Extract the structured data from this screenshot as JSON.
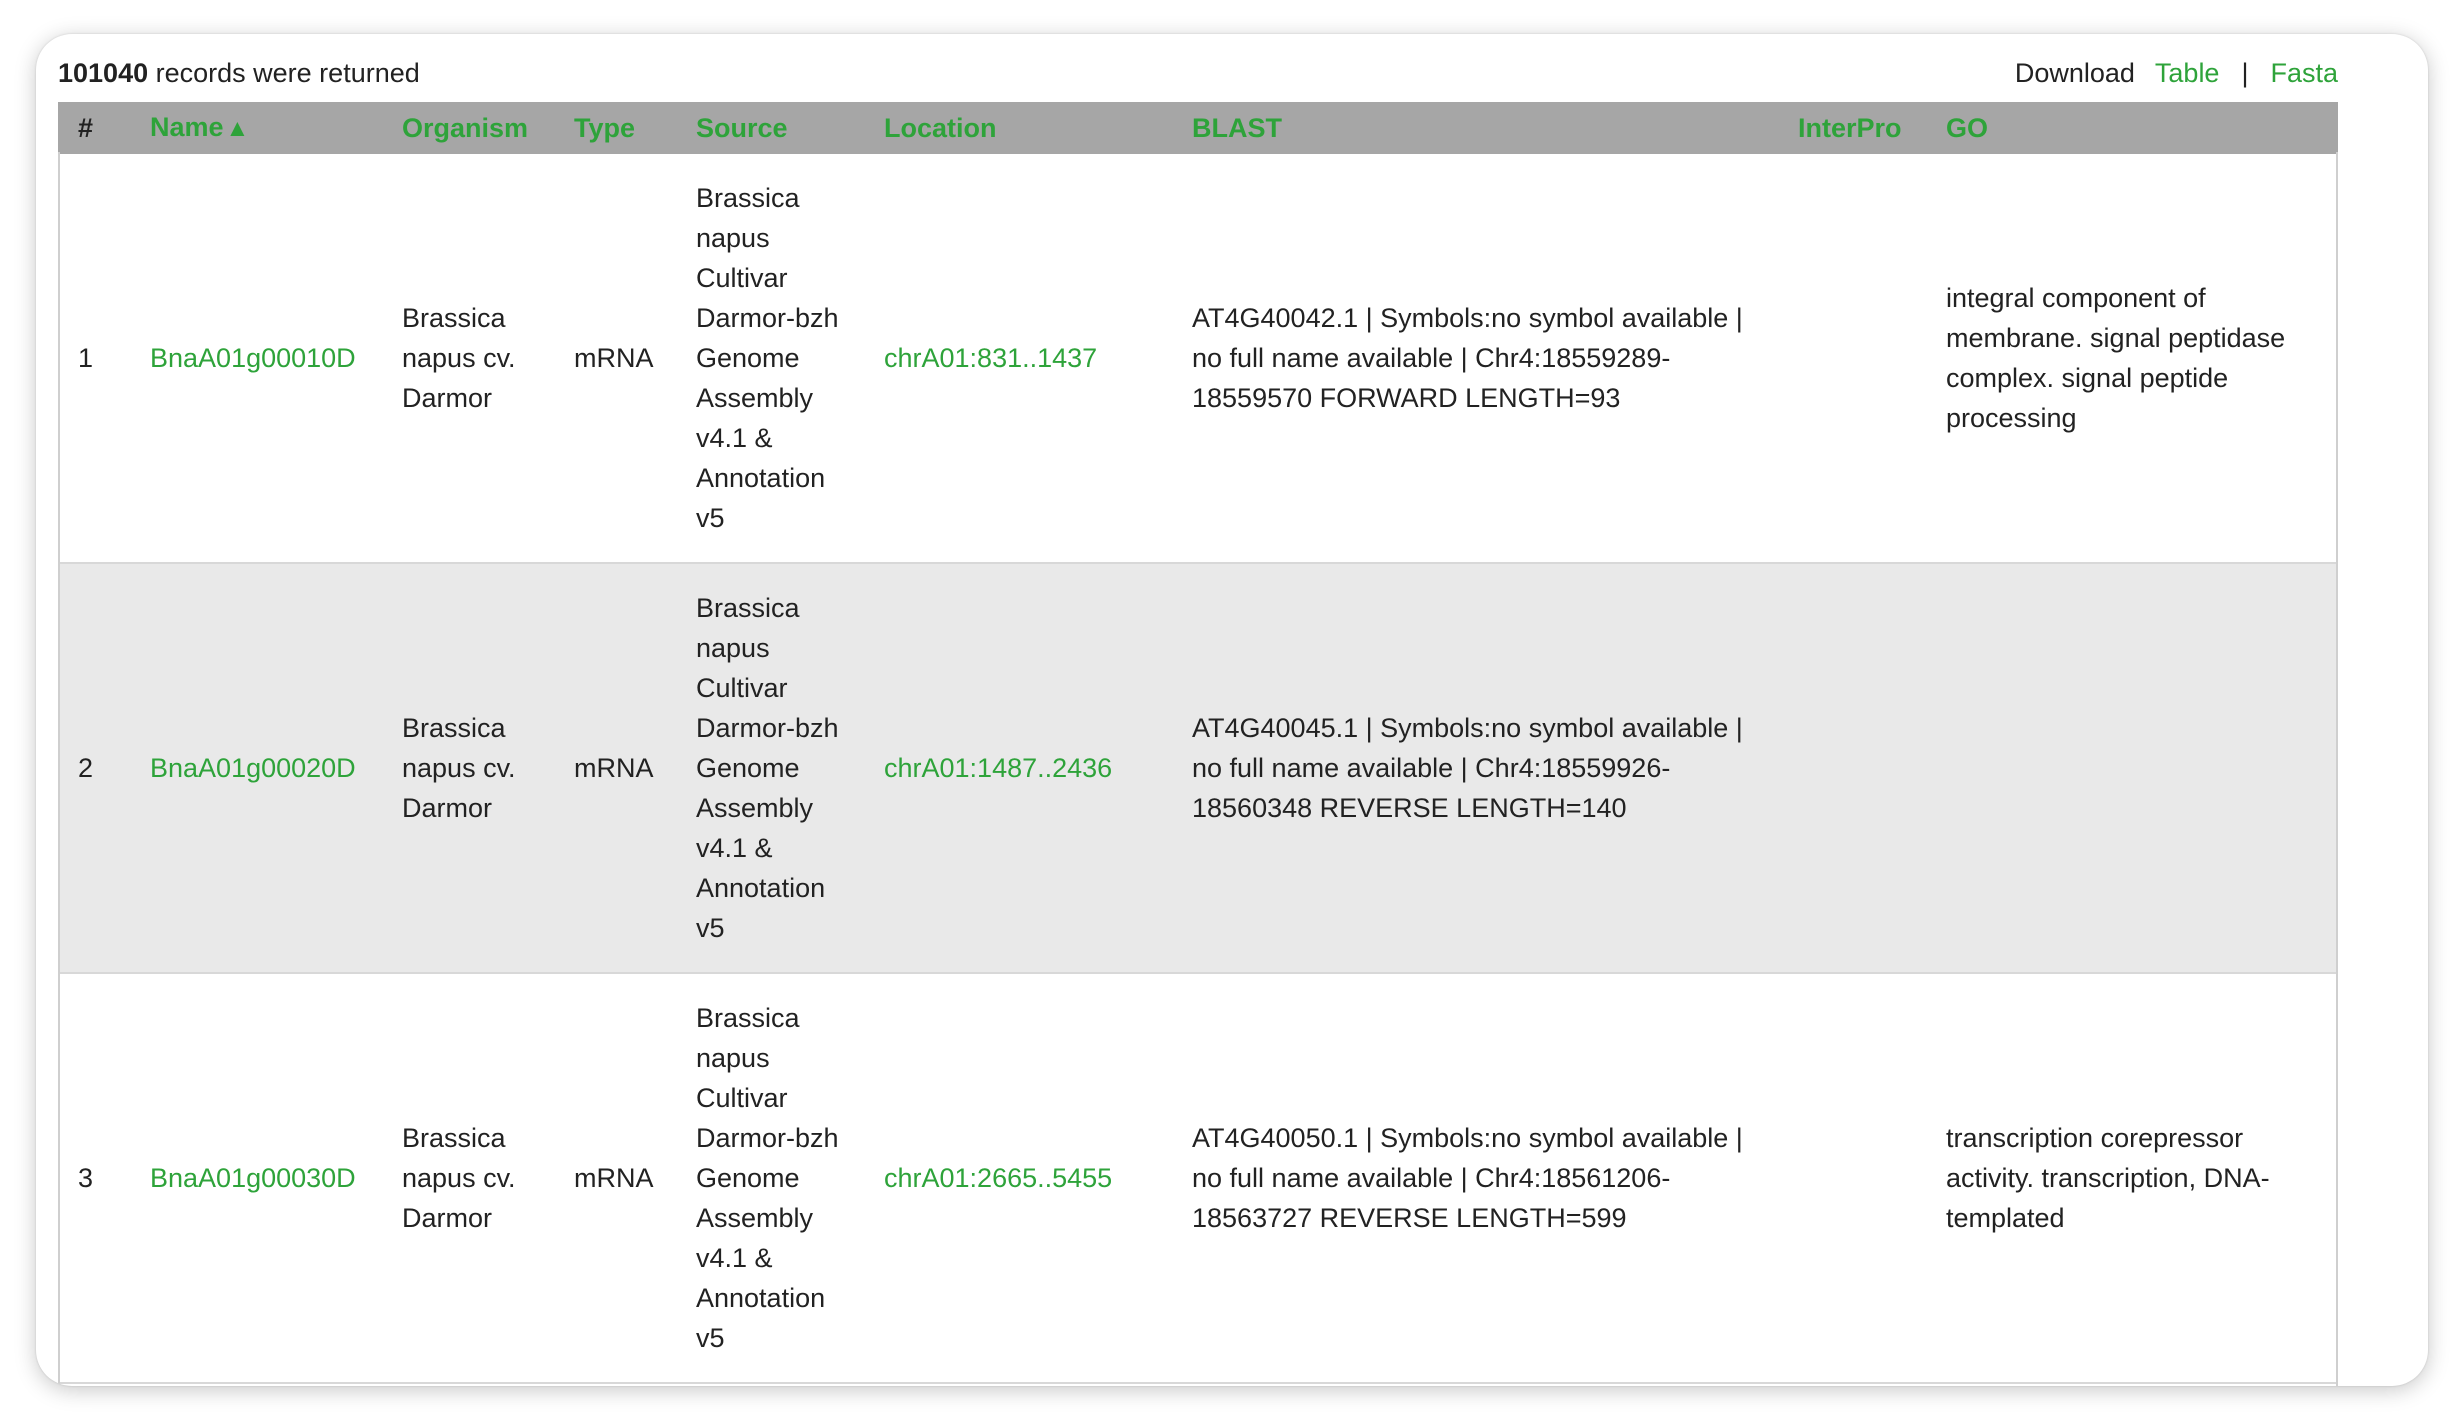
{
  "summary": {
    "count": "101040",
    "text": "records were returned"
  },
  "download": {
    "label": "Download",
    "table_link": "Table",
    "separator": "|",
    "fasta_link": "Fasta"
  },
  "columns": {
    "num": "#",
    "name": "Name",
    "name_sort_icon": "▲",
    "organism": "Organism",
    "type": "Type",
    "source": "Source",
    "location": "Location",
    "blast": "BLAST",
    "interpro": "InterPro",
    "go": "GO"
  },
  "rows": [
    {
      "num": "1",
      "name": "BnaA01g00010D",
      "organism": "Brassica napus cv. Darmor",
      "type": "mRNA",
      "source": "Brassica napus Cultivar Darmor-bzh Genome Assembly v4.1 & Annotation v5",
      "location": "chrA01:831..1437",
      "blast": "AT4G40042.1 | Symbols:no symbol available | no full name available | Chr4:18559289-18559570 FORWARD LENGTH=93",
      "interpro": "",
      "go": "integral component of membrane. signal peptidase complex. signal peptide processing"
    },
    {
      "num": "2",
      "name": "BnaA01g00020D",
      "organism": "Brassica napus cv. Darmor",
      "type": "mRNA",
      "source": "Brassica napus Cultivar Darmor-bzh Genome Assembly v4.1 & Annotation v5",
      "location": "chrA01:1487..2436",
      "blast": "AT4G40045.1 | Symbols:no symbol available | no full name available | Chr4:18559926-18560348 REVERSE LENGTH=140",
      "interpro": "",
      "go": ""
    },
    {
      "num": "3",
      "name": "BnaA01g00030D",
      "organism": "Brassica napus cv. Darmor",
      "type": "mRNA",
      "source": "Brassica napus Cultivar Darmor-bzh Genome Assembly v4.1 & Annotation v5",
      "location": "chrA01:2665..5455",
      "blast": "AT4G40050.1 | Symbols:no symbol available | no full name available | Chr4:18561206-18563727 REVERSE LENGTH=599",
      "interpro": "",
      "go": "transcription corepressor activity. transcription, DNA-templated"
    }
  ],
  "colors": {
    "link": "#2ea33a",
    "header_bg": "#a6a6a6",
    "alt_row_bg": "#e9e9e9"
  }
}
